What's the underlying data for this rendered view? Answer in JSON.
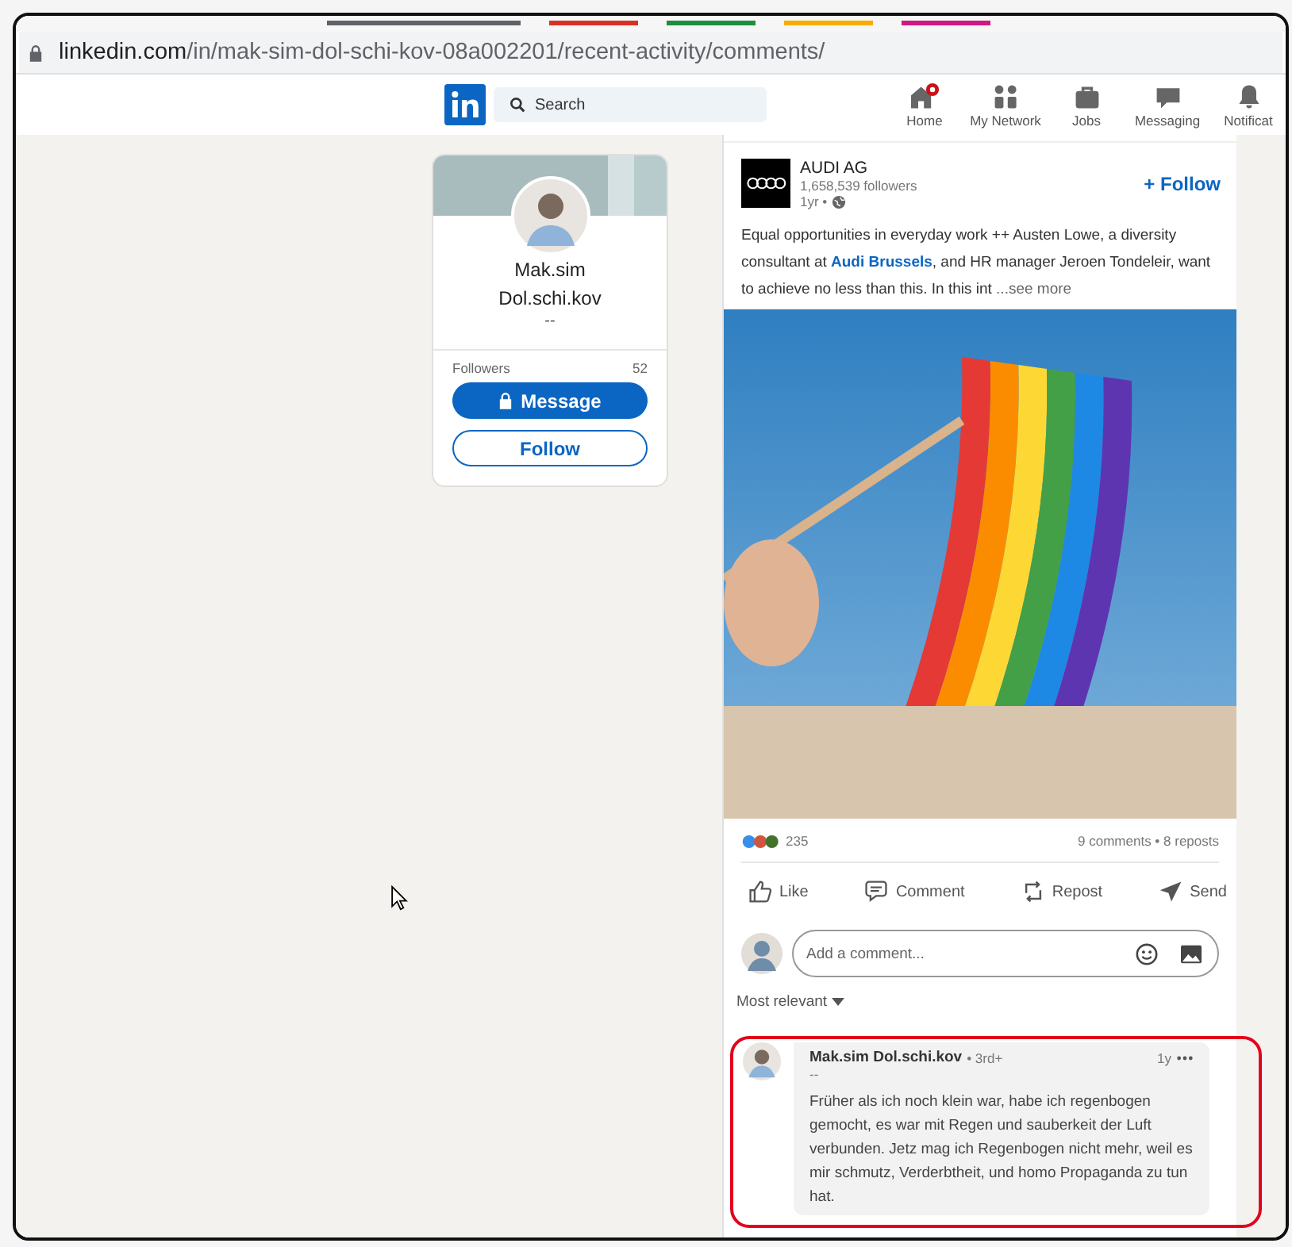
{
  "browser": {
    "tab_colors": [
      {
        "color": "#5f6368"
      },
      {
        "color": "#d93025"
      },
      {
        "color": "#1e8e3e"
      },
      {
        "color": "#f9ab00"
      },
      {
        "color": "#d01884"
      }
    ],
    "url_domain": "linkedin.com",
    "url_path": "/in/mak-sim-dol-schi-kov-08a002201/recent-activity/comments/"
  },
  "nav": {
    "search_placeholder": "Search",
    "items": [
      {
        "kind": "home",
        "label": "Home"
      },
      {
        "kind": "network",
        "label": "My Network"
      },
      {
        "kind": "jobs",
        "label": "Jobs"
      },
      {
        "kind": "messaging",
        "label": "Messaging"
      },
      {
        "kind": "notifications",
        "label": "Notificat"
      }
    ]
  },
  "profile_card": {
    "name_lines": [
      "Mak.sim",
      "Dol.schi.kov"
    ],
    "headline": "--",
    "followers_label": "Followers",
    "followers_count": "52",
    "message_button": "Message",
    "follow_button": "Follow"
  },
  "post": {
    "author": "AUDI AG",
    "followers": "1,658,539 followers",
    "age": "1yr •",
    "follow_button": "+ Follow",
    "text_before": "Equal opportunities in everyday work ++ Austen Lowe, a diversity consultant at ",
    "link": "Audi Brussels",
    "text_after": ", and HR manager Jeroen Tondeleir, want to achieve no less than this. In this int",
    "see_more": "...see more",
    "reaction_count": "235",
    "stats": "9 comments • 8 reposts",
    "actions": [
      {
        "kind": "like",
        "label": "Like"
      },
      {
        "kind": "comment",
        "label": "Comment"
      },
      {
        "kind": "repost",
        "label": "Repost"
      },
      {
        "kind": "send",
        "label": "Send"
      }
    ],
    "comment_placeholder": "Add a comment...",
    "sort": "Most relevant"
  },
  "comment": {
    "author": "Mak.sim Dol.schi.kov",
    "degree": "• 3rd+",
    "age": "1y",
    "headline": "--",
    "text": "Früher als ich noch klein war, habe ich regenbogen gemocht, es war mit Regen und sauberkeit der Luft verbunden. Jetz mag ich Regenbogen nicht mehr, weil es mir schmutz, Verderbtheit, und homo Propaganda zu tun hat."
  }
}
